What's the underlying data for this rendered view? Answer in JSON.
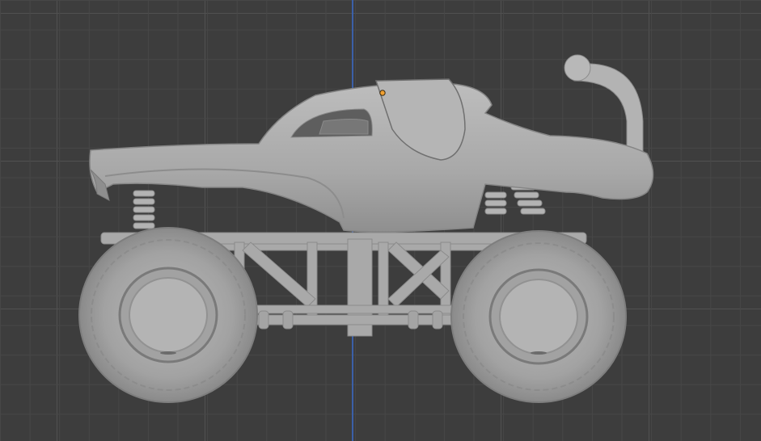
{
  "viewport": {
    "mode": "3d-viewport",
    "background_color": "#3d3d3d",
    "grid_color": "#474747",
    "axis_color": "#3a63b2",
    "origin_color": "#f0a030"
  },
  "model": {
    "icon": "monster-truck-mesh",
    "body_color": "#a9a9a9",
    "shadow_color": "#7f7f7f",
    "edge_color": "#5f5f5f"
  }
}
